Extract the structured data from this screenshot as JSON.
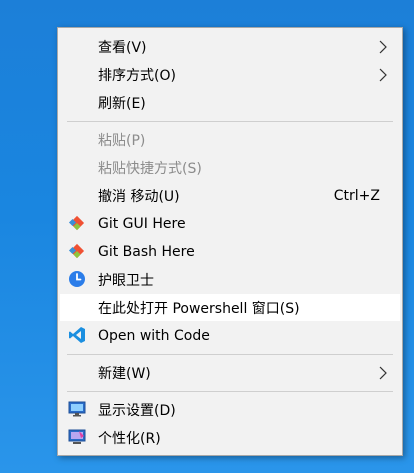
{
  "menu": {
    "items": [
      {
        "label": "查看(V)",
        "submenu": true
      },
      {
        "label": "排序方式(O)",
        "submenu": true
      },
      {
        "label": "刷新(E)"
      },
      {
        "label": "粘贴(P)",
        "disabled": true
      },
      {
        "label": "粘贴快捷方式(S)",
        "disabled": true
      },
      {
        "label": "撤消 移动(U)",
        "shortcut": "Ctrl+Z"
      },
      {
        "label": "Git GUI Here",
        "icon": "git-gui-icon"
      },
      {
        "label": "Git Bash Here",
        "icon": "git-bash-icon"
      },
      {
        "label": "护眼卫士",
        "icon": "eye-guard-icon"
      },
      {
        "label": "在此处打开 Powershell 窗口(S)",
        "hovered": true
      },
      {
        "label": "Open with Code",
        "icon": "vscode-icon"
      },
      {
        "label": "新建(W)",
        "submenu": true
      },
      {
        "label": "显示设置(D)",
        "icon": "display-settings-icon"
      },
      {
        "label": "个性化(R)",
        "icon": "personalize-icon"
      }
    ]
  },
  "colors": {
    "desktop": "#1c7fd8",
    "menu_bg": "#f2f2f2",
    "hover_bg": "#ffffff",
    "disabled_text": "#8c8c8c",
    "git_orange": "#f05133",
    "vscode_blue": "#1b8fe0",
    "eye_guard_blue": "#2b7de9"
  }
}
